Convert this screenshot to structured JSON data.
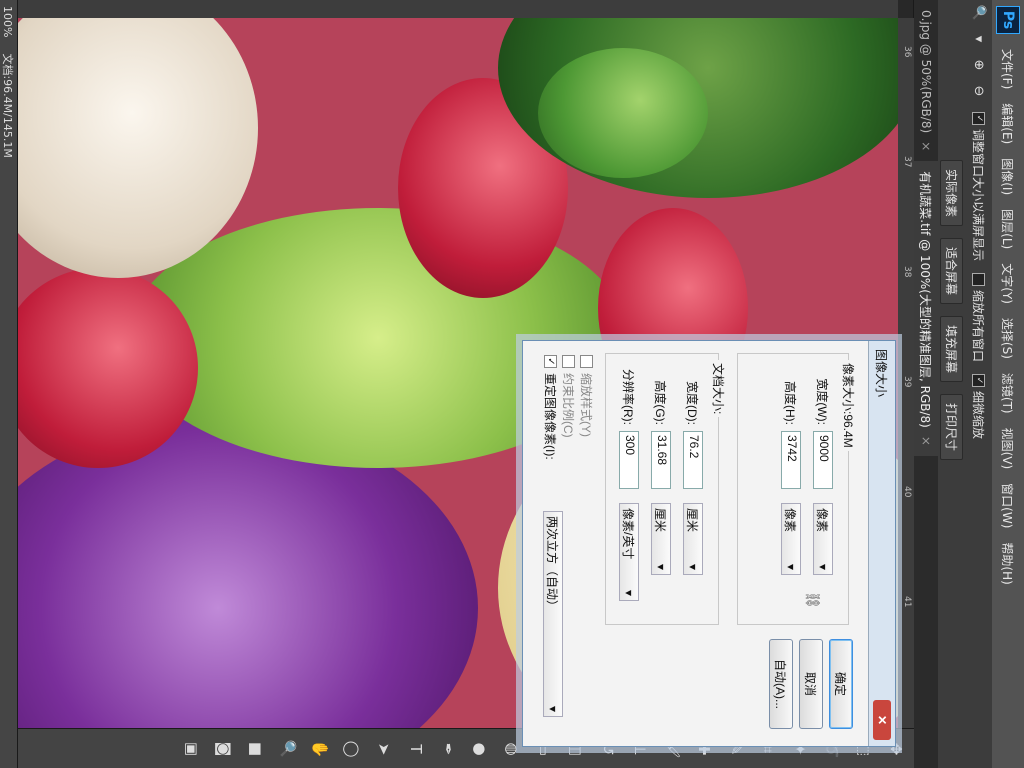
{
  "menubar": {
    "logo": "Ps",
    "items": [
      "文件(F)",
      "编辑(E)",
      "图像(I)",
      "图层(L)",
      "文字(Y)",
      "选择(S)",
      "滤镜(T)",
      "视图(V)",
      "窗口(W)",
      "帮助(H)"
    ]
  },
  "options": {
    "resize_window": "调整窗口大小以满屏显示",
    "zoom_all": "缩放所有窗口",
    "scrubby_zoom": "细微缩放",
    "actual_pixels": "实际像素",
    "fit_screen": "适合屏幕",
    "fill_screen": "填充屏幕",
    "print_size": "打印尺寸"
  },
  "tabs": [
    {
      "label": "0.jpg @ 50%(RGB/8)",
      "close": "×"
    },
    {
      "label": "有机蔬菜.tif @ 100%(大型的精准图层, RGB/8)",
      "close": "×"
    }
  ],
  "ruler": {
    "marks": [
      "36",
      "37",
      "38",
      "39",
      "40",
      "41"
    ]
  },
  "status": {
    "zoom": "100%",
    "doc": "文档:96.4M/145.1M"
  },
  "dialog": {
    "title": "图像大小",
    "close": "✕",
    "pixel_dimensions": "像素大小:96.4M",
    "width_label": "宽度(W):",
    "width_value": "9000",
    "width_unit": "像素",
    "height_label": "高度(H):",
    "height_value": "3742",
    "height_unit": "像素",
    "doc_size": "文档大小:",
    "doc_width_label": "宽度(D):",
    "doc_width_value": "76.2",
    "doc_width_unit": "厘米",
    "doc_height_label": "高度(G):",
    "doc_height_value": "31.68",
    "doc_height_unit": "厘米",
    "resolution_label": "分辨率(R):",
    "resolution_value": "300",
    "resolution_unit": "像素/英寸",
    "scale_styles": "缩放样式(Y)",
    "constrain": "约束比例(C)",
    "resample": "重定图像像素(I):",
    "resample_method": "两次立方（自动）",
    "ok": "确定",
    "cancel": "取消",
    "auto": "自动(A)..."
  }
}
